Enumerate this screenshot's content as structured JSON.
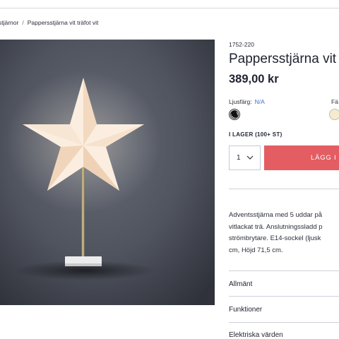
{
  "breadcrumb": {
    "parent": "stjärnor",
    "separator": "/",
    "current": "Pappersstjärna vit träfot vit"
  },
  "product": {
    "sku": "1752-220",
    "title": "Pappersstjärna vit",
    "price": "389,00 kr",
    "image_icon": "paper-star-lamp-image"
  },
  "options": {
    "light_color_label": "Ljusfärg:",
    "light_color_value": "N/A",
    "color_label_partial": "Fä",
    "swatch_colors": [
      "#ffffff",
      "#f6ebcf"
    ]
  },
  "stock_status": "I LAGER (100+ ST)",
  "quantity": {
    "value": "1"
  },
  "add_to_cart_label": "LÄGG I V",
  "description_lines": [
    "Adventsstjärna med 5 uddar på",
    "vitlackat trä. Anslutningssladd p",
    "strömbrytare. E14-sockel (ljusk",
    "cm, Höjd 71,5 cm."
  ],
  "accordion": [
    "Allmänt",
    "Funktioner",
    "Elektriska värden"
  ],
  "colors": {
    "accent": "#e35d62",
    "link": "#3d6fd0"
  }
}
